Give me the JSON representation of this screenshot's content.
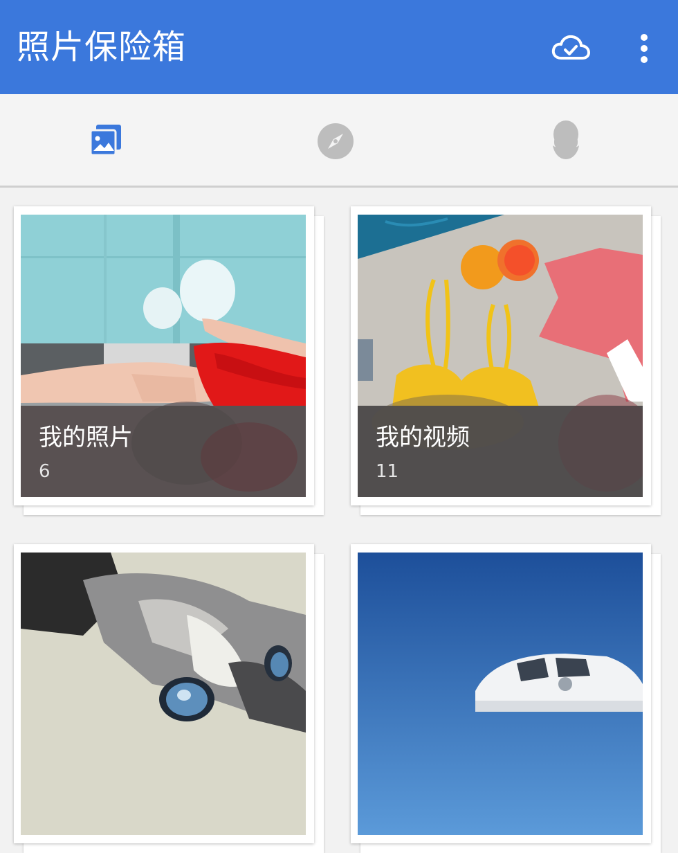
{
  "app_bar": {
    "title": "照片保险箱",
    "background_color": "#3b78dc",
    "actions": [
      {
        "icon": "cloud-check-icon"
      },
      {
        "icon": "more-vert-icon"
      }
    ]
  },
  "tabs": [
    {
      "icon": "photo-library-icon",
      "selected": true,
      "color": "#3b78dc"
    },
    {
      "icon": "compass-icon",
      "selected": false,
      "color": "#bdbdbd"
    },
    {
      "icon": "person-icon",
      "selected": false,
      "color": "#bdbdbd"
    }
  ],
  "albums": [
    {
      "title": "我的照片",
      "count": "6",
      "thumbnail": "woman-in-red-dress-by-pool"
    },
    {
      "title": "我的视频",
      "count": "11",
      "thumbnail": "swimsuit-oranges-shirt-flatlay"
    },
    {
      "title": "",
      "count": "",
      "thumbnail": "cat-face-closeup"
    },
    {
      "title": "",
      "count": "",
      "thumbnail": "white-car-blue-sky"
    }
  ]
}
